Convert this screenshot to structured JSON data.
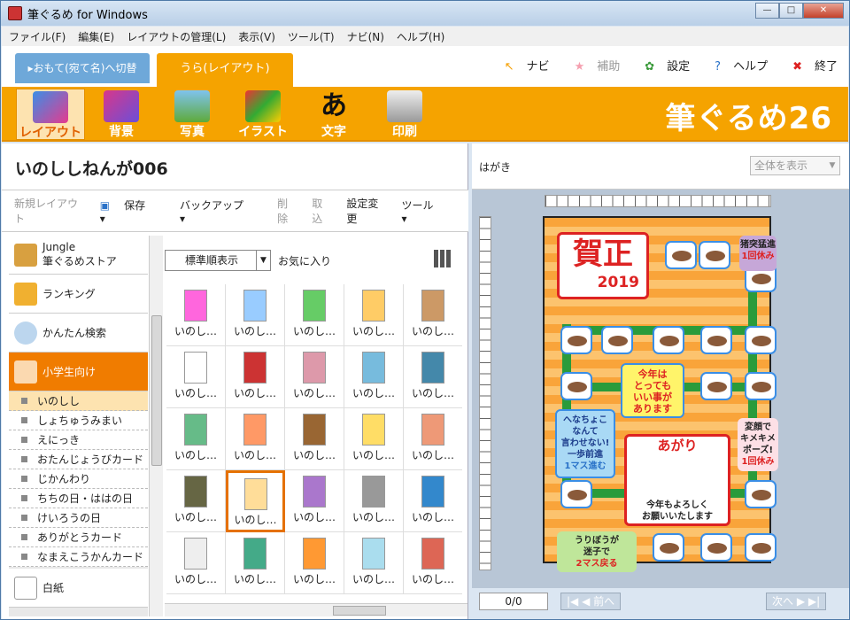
{
  "window": {
    "title": "筆ぐるめ for Windows",
    "min": "—",
    "max": "□",
    "close": "✕"
  },
  "menu": [
    "ファイル(F)",
    "編集(E)",
    "レイアウトの管理(L)",
    "表示(V)",
    "ツール(T)",
    "ナビ(N)",
    "ヘルプ(H)"
  ],
  "tabs": {
    "front": "▸おもて(宛て名)へ切替",
    "back": "うら(レイアウト)"
  },
  "toolnav": {
    "navi": "ナビ",
    "hojo": "補助",
    "settei": "設定",
    "help": "ヘルプ",
    "exit": "終了"
  },
  "ribbon": {
    "items": [
      "レイアウト",
      "背景",
      "写真",
      "イラスト",
      "文字",
      "印刷"
    ],
    "logo": "筆ぐるめ26"
  },
  "left": {
    "heading": "いのししねんが006",
    "toolbar": [
      "新規レイアウト",
      "保存",
      "バックアップ",
      "削除",
      "取込",
      "設定変更",
      "ツール"
    ]
  },
  "cats": {
    "store_line1": "Jungle",
    "store_line2": "筆ぐるめストア",
    "ranking": "ランキング",
    "search": "かんたん検索",
    "shougakusei": "小学生向け",
    "plain": "白紙"
  },
  "subs": [
    "いのしし",
    "しょちゅうみまい",
    "えにっき",
    "おたんじょうびカード",
    "じかんわり",
    "ちちの日・ははの日",
    "けいろうの日",
    "ありがとうカード",
    "なまえこうかんカード"
  ],
  "grid": {
    "sort": "標準順表示",
    "fav": "お気に入り",
    "thumb_label": "いのし…"
  },
  "right": {
    "label": "はがき",
    "zoom": "全体を表示"
  },
  "card": {
    "gashou": "賀正",
    "year": "2019",
    "b1_title": "猪突猛進",
    "b1_sub": "1回休み",
    "b2_1": "今年は",
    "b2_2": "とっても",
    "b2_3": "いい事が",
    "b2_4": "あります",
    "b3_1": "へなちょこ",
    "b3_2": "なんて",
    "b3_3": "言わせない!",
    "b3_4": "一歩前進",
    "b3_5": "1マス進む",
    "b4_1": "変顔で",
    "b4_2": "キメキメ",
    "b4_3": "ポーズ!",
    "b4_4": "1回休み",
    "agari": "あがり",
    "msg1": "今年もよろしく",
    "msg2": "お願いいたします",
    "b5_1": "うりぼうが",
    "b5_2": "迷子で",
    "b5_3": "2マス戻る"
  },
  "pager": {
    "page": "0/0",
    "prev": "|◀ ◀ 前へ",
    "next": "次へ ▶ ▶|"
  }
}
